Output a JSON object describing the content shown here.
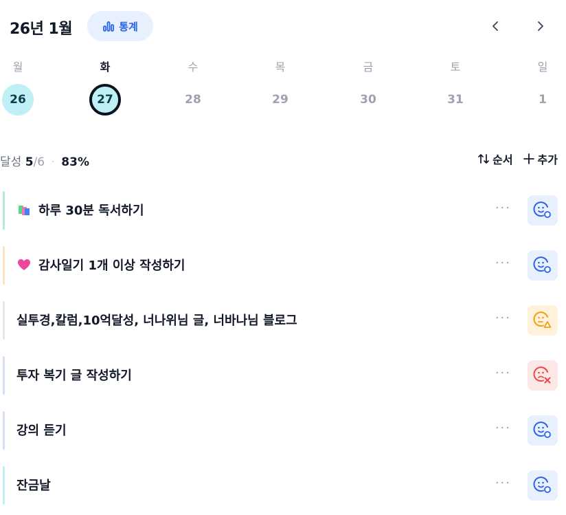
{
  "header": {
    "title": "26년 1월",
    "stats_label": "통계",
    "stats_icon": "bar-chart-icon",
    "prev_icon": "chevron-left-icon",
    "next_icon": "chevron-right-icon"
  },
  "week": {
    "days": [
      "월",
      "화",
      "수",
      "목",
      "금",
      "토",
      "일"
    ],
    "dates": [
      "26",
      "27",
      "28",
      "29",
      "30",
      "31",
      "1"
    ],
    "selected_index": 1
  },
  "summary": {
    "label": "달성",
    "done": "5",
    "total": "/6",
    "separator": "·",
    "percent": "83%"
  },
  "actions": {
    "order_label": "순서",
    "add_label": "추가"
  },
  "tasks": [
    {
      "label": "하루 30분 독서하기",
      "icon": "books-icon",
      "bar_color": "#b8eadb",
      "status": "happy",
      "status_color": "#2563eb",
      "status_bg": "#e8effd"
    },
    {
      "label": "감사일기 1개 이상 작성하기",
      "icon": "heart-icon",
      "bar_color": "#fde3c8",
      "status": "happy",
      "status_color": "#2563eb",
      "status_bg": "#e8effd"
    },
    {
      "label": "실투경,칼럼,10억달성, 너나위님 글, 너바나님 블로그",
      "icon": "",
      "bar_color": "#e5e7eb",
      "status": "warning",
      "status_color": "#f59e0b",
      "status_bg": "#fff1dc"
    },
    {
      "label": "투자 복기 글 작성하기",
      "icon": "",
      "bar_color": "#d6e0f5",
      "status": "fail",
      "status_color": "#ef4444",
      "status_bg": "#fde8e8"
    },
    {
      "label": "강의 듣기",
      "icon": "",
      "bar_color": "#d6e0f5",
      "status": "happy",
      "status_color": "#2563eb",
      "status_bg": "#e8effd"
    },
    {
      "label": "잔금날",
      "icon": "",
      "bar_color": "#bfeff5",
      "status": "happy",
      "status_color": "#2563eb",
      "status_bg": "#e8effd"
    }
  ],
  "more_label": "···"
}
